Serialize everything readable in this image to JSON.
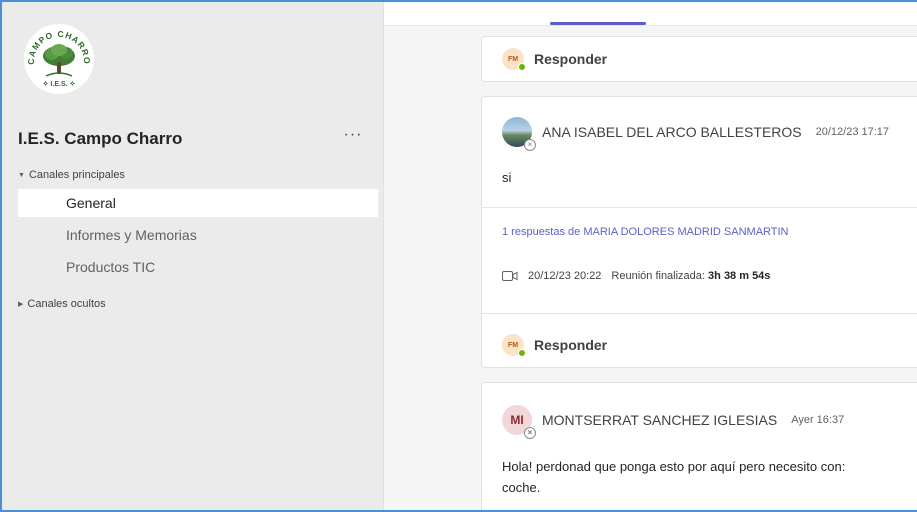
{
  "sidebar": {
    "logo_text": [
      "CAMPO CHARRO",
      "I.E.S."
    ],
    "team_name": "I.E.S. Campo Charro",
    "more_label": "···",
    "sections": [
      {
        "label": "Canales principales",
        "expanded": true,
        "channels": [
          {
            "label": "General",
            "active": true
          },
          {
            "label": "Informes y Memorias",
            "active": false
          },
          {
            "label": "Productos TIC",
            "active": false
          }
        ]
      },
      {
        "label": "Canales ocultos",
        "expanded": false,
        "channels": []
      }
    ]
  },
  "main": {
    "reply_label": "Responder",
    "reply_avatar_initials": "FM",
    "messages": [
      {
        "author": "ANA ISABEL DEL ARCO BALLESTEROS",
        "timestamp": "20/12/23 17:17",
        "body": "si",
        "replies_link": "1 respuestas de MARIA DOLORES MADRID SANMARTIN",
        "meeting": {
          "datetime": "20/12/23 20:22",
          "label": "Reunión finalizada:",
          "duration": "3h 38 m 54s"
        }
      },
      {
        "author": "MONTSERRAT SANCHEZ IGLESIAS",
        "avatar_initials": "MI",
        "timestamp": "Ayer 16:37",
        "body_line1": "Hola! perdonad que ponga esto por aquí pero necesito con:",
        "body_line2": "coche."
      }
    ]
  },
  "colors": {
    "accent": "#5b5fc7",
    "sidebar_bg": "#ebebeb",
    "main_bg": "#f5f5f5",
    "presence_available": "#6bb700",
    "frame_border": "#4a90d9"
  },
  "icons": [
    "school-logo",
    "more-options-icon",
    "caret-down-icon",
    "caret-right-icon",
    "video-meeting-icon",
    "presence-available-icon",
    "presence-offline-icon"
  ]
}
